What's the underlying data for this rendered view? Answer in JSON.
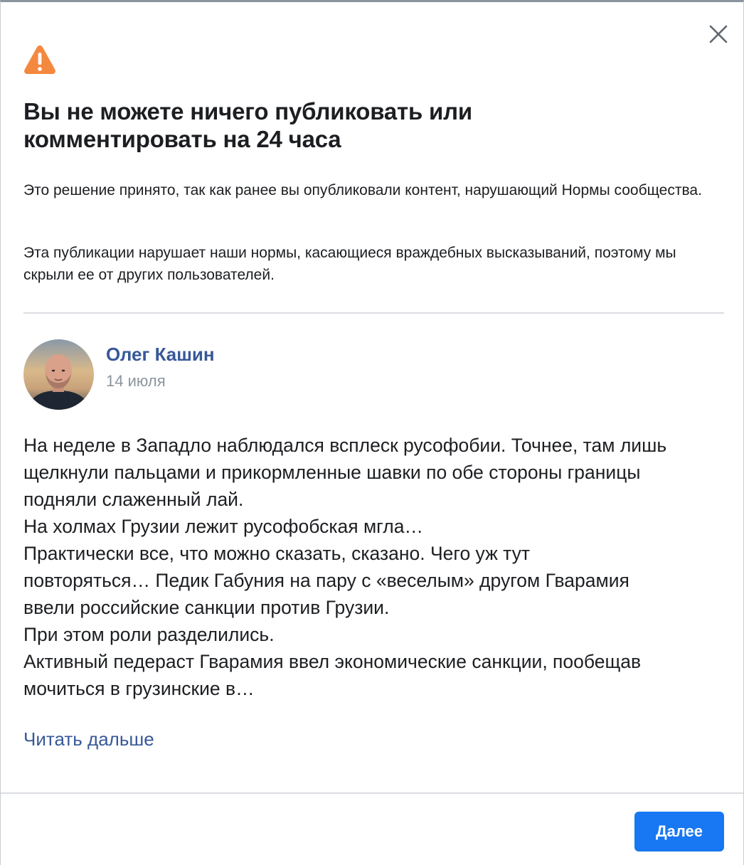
{
  "dialog": {
    "title": "Вы не можете ничего публиковать или комментировать на 24 часа",
    "paragraphs": [
      "Это решение принято, так как ранее вы опубликовали контент, нарушающий Нормы сообщества.",
      "Эта публикации нарушает наши нормы, касающиеся враждебных высказываний, поэтому мы скрыли ее от других пользователей."
    ],
    "close_icon": "close-icon",
    "warning_icon": "warning-triangle-icon",
    "warning_color": "#f5883f"
  },
  "post": {
    "author": "Олег Кашин",
    "date": "14 июля",
    "lines": [
      "На неделе в Западло наблюдался всплеск русофобии. Точнее, там лишь",
      "щелкнули пальцами и прикормленные шавки по обе стороны границы",
      "подняли слаженный лай.",
      "На холмах Грузии лежит русофобская мгла…",
      "Практически все, что можно сказать, сказано. Чего уж тут",
      "повторяться… Педик Габуния на пару с «веселым» другом Гварамия",
      "ввели российские санкции против Грузии.",
      "При этом роли разделились.",
      "Активный педераст Гварамия ввел экономические санкции, пообещав",
      "мочиться в грузинские в…"
    ],
    "read_more": "Читать дальше"
  },
  "footer": {
    "next_label": "Далее",
    "accent_color": "#1877f2",
    "link_color": "#385898"
  }
}
